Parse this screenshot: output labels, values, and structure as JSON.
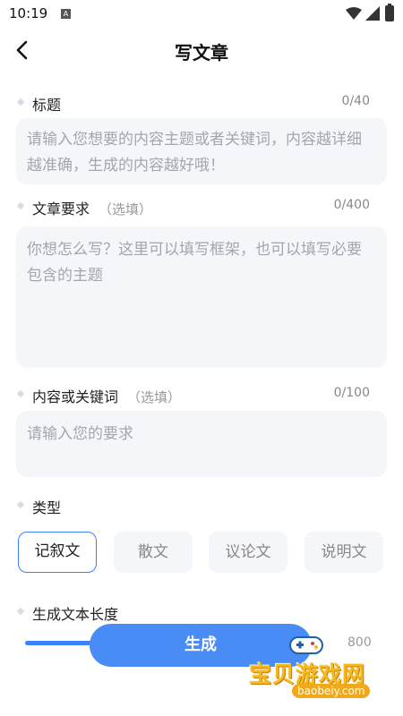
{
  "status": {
    "time": "10:19",
    "notification_glyph": "A"
  },
  "header": {
    "title": "写文章"
  },
  "fields": {
    "title": {
      "label": "标题",
      "count": "0/40",
      "placeholder": "请输入您想要的内容主题或者关键词，内容越详细越准确，生成的内容越好哦！"
    },
    "requirements": {
      "label": "文章要求",
      "optional": "（选填）",
      "count": "0/400",
      "placeholder": "你想怎么写？这里可以填写框架，也可以填写必要包含的主题"
    },
    "keywords": {
      "label": "内容或关键词",
      "optional": "（选填）",
      "count": "0/100",
      "placeholder": "请输入您的要求"
    }
  },
  "type_section": {
    "label": "类型",
    "options": [
      "记叙文",
      "散文",
      "议论文",
      "说明文"
    ],
    "selected": "记叙文"
  },
  "length_section": {
    "label": "生成文本长度",
    "max": "800"
  },
  "generate_label": "生成",
  "watermark": {
    "brand": "宝贝游戏网",
    "domain": "baobeiy.com"
  },
  "colors": {
    "accent": "#3b82f6",
    "button": "#4a8cf6",
    "field_bg": "#f5f6fa",
    "watermark": "#f5b81f"
  }
}
